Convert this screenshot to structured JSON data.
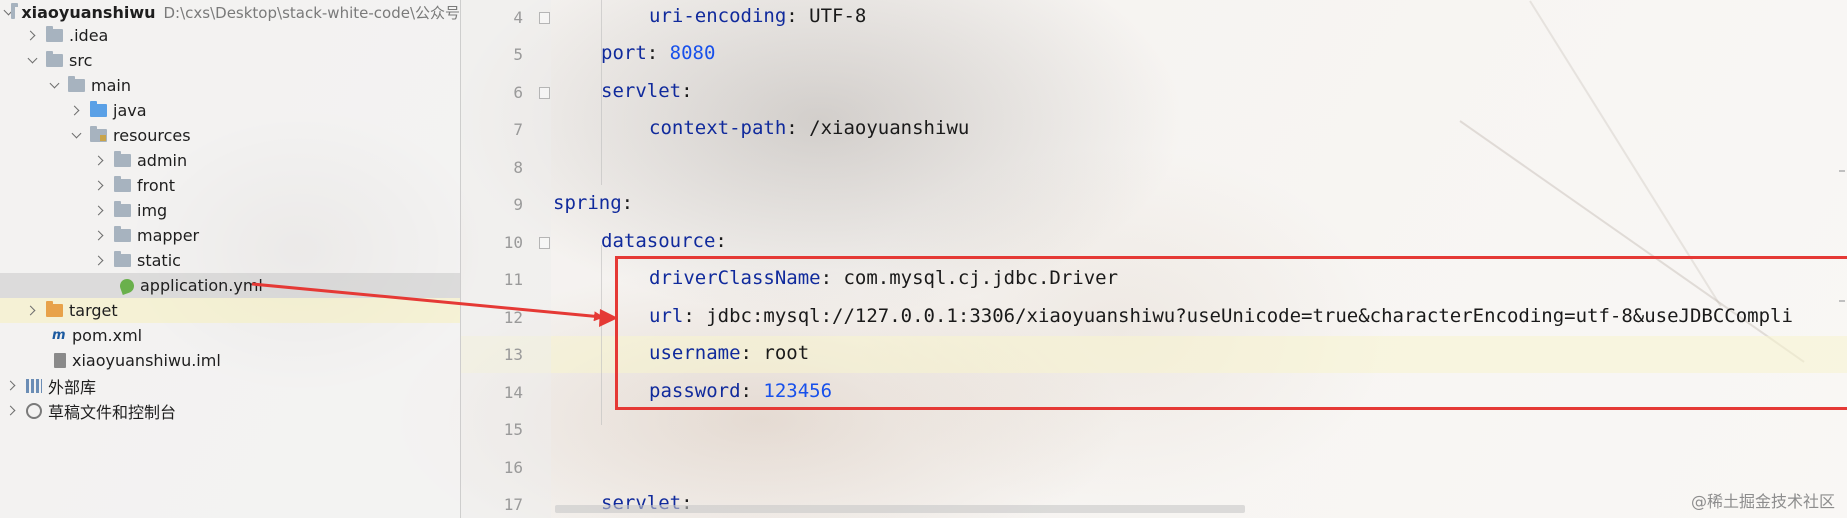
{
  "project_tree": {
    "project_name": "xiaoyuanshiwu",
    "project_path": "D:\\cxs\\Desktop\\stack-white-code\\公众号",
    "items": [
      {
        "label": ".idea"
      },
      {
        "label": "src"
      },
      {
        "label": "main"
      },
      {
        "label": "java"
      },
      {
        "label": "resources"
      },
      {
        "label": "admin"
      },
      {
        "label": "front"
      },
      {
        "label": "img"
      },
      {
        "label": "mapper"
      },
      {
        "label": "static"
      },
      {
        "label": "application.yml"
      },
      {
        "label": "target"
      },
      {
        "label": "pom.xml"
      },
      {
        "label": "xiaoyuanshiwu.iml"
      },
      {
        "label": "外部库"
      },
      {
        "label": "草稿文件和控制台"
      }
    ]
  },
  "editor": {
    "line_numbers": [
      "4",
      "5",
      "6",
      "7",
      "8",
      "9",
      "10",
      "11",
      "12",
      "13",
      "14",
      "15",
      "16",
      "17"
    ],
    "lines": [
      {
        "key": "uri-encoding",
        "sep": ": ",
        "value": "UTF-8"
      },
      {
        "key": "port",
        "sep": ": ",
        "value": "8080"
      },
      {
        "key": "servlet",
        "sep": ":",
        "value": ""
      },
      {
        "key": "context-path",
        "sep": ": ",
        "value": "/xiaoyuanshiwu"
      },
      {
        "key": "",
        "sep": "",
        "value": ""
      },
      {
        "key": "spring",
        "sep": ":",
        "value": ""
      },
      {
        "key": "datasource",
        "sep": ":",
        "value": ""
      },
      {
        "key": "driverClassName",
        "sep": ": ",
        "value": "com.mysql.cj.jdbc.Driver"
      },
      {
        "key": "url",
        "sep": ": ",
        "value": "jdbc:mysql://127.0.0.1:3306/xiaoyuanshiwu?useUnicode=true&characterEncoding=utf-8&useJDBCCompli"
      },
      {
        "key": "username",
        "sep": ": ",
        "value": "root"
      },
      {
        "key": "password",
        "sep": ": ",
        "value": "123456"
      },
      {
        "key": "",
        "sep": "",
        "value": ""
      },
      {
        "key": "",
        "sep": "",
        "value": ""
      },
      {
        "key": "servlet",
        "sep": ":",
        "value": ""
      }
    ]
  },
  "watermark": "@稀土掘金技术社区",
  "colors": {
    "key": "#102a9c",
    "number": "#1750eb",
    "annotation": "#e53935"
  }
}
